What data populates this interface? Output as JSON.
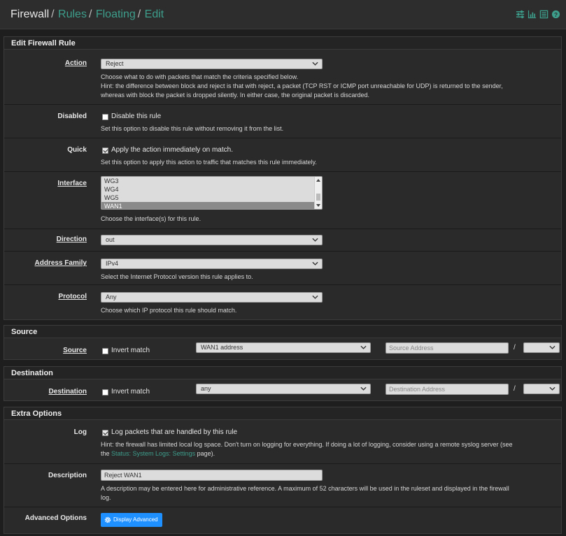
{
  "breadcrumb": {
    "firewall": "Firewall",
    "rules": "Rules",
    "floating": "Floating",
    "edit": "Edit",
    "sep": "/"
  },
  "header_icons": [
    "sliders-icon",
    "bar-chart-icon",
    "list-icon",
    "help-icon"
  ],
  "edit_panel": {
    "title": "Edit Firewall Rule",
    "action": {
      "label": "Action",
      "value": "Reject",
      "help1": "Choose what to do with packets that match the criteria specified below.",
      "help2": "Hint: the difference between block and reject is that with reject, a packet (TCP RST or ICMP port unreachable for UDP) is returned to the sender,",
      "help3": "whereas with block the packet is dropped silently. In either case, the original packet is discarded."
    },
    "disabled": {
      "label": "Disabled",
      "checkbox": "Disable this rule",
      "checked": false,
      "help": "Set this option to disable this rule without removing it from the list."
    },
    "quick": {
      "label": "Quick",
      "checkbox": "Apply the action immediately on match.",
      "checked": true,
      "help": "Set this option to apply this action to traffic that matches this rule immediately."
    },
    "interface": {
      "label": "Interface",
      "options": [
        "WG3",
        "WG4",
        "WG5",
        "WAN1"
      ],
      "selected": "WAN1",
      "help": "Choose the interface(s) for this rule."
    },
    "direction": {
      "label": "Direction",
      "value": "out"
    },
    "address_family": {
      "label": "Address Family",
      "value": "IPv4",
      "help": "Select the Internet Protocol version this rule applies to."
    },
    "protocol": {
      "label": "Protocol",
      "value": "Any",
      "help": "Choose which IP protocol this rule should match."
    }
  },
  "source_panel": {
    "title": "Source",
    "label": "Source",
    "invert": "Invert match",
    "type": "WAN1 address",
    "address_placeholder": "Source Address",
    "slash": "/"
  },
  "destination_panel": {
    "title": "Destination",
    "label": "Destination",
    "invert": "Invert match",
    "type": "any",
    "address_placeholder": "Destination Address",
    "slash": "/"
  },
  "extra_panel": {
    "title": "Extra Options",
    "log": {
      "label": "Log",
      "checkbox": "Log packets that are handled by this rule",
      "checked": true,
      "help1": "Hint: the firewall has limited local log space. Don't turn on logging for everything. If doing a lot of logging, consider using a remote syslog server (see",
      "help2_pre": "the ",
      "help2_link": "Status: System Logs: Settings",
      "help2_post": " page)."
    },
    "description": {
      "label": "Description",
      "value": "Reject WAN1",
      "help1": "A description may be entered here for administrative reference. A maximum of 52 characters will be used in the ruleset and displayed in the firewall",
      "help2": "log."
    },
    "advanced": {
      "label": "Advanced Options",
      "button": "Display Advanced"
    }
  },
  "colors": {
    "accent": "#3d9e8c",
    "button": "#1e90ff",
    "panel": "#2a2a2a",
    "background": "#1e1e1e"
  }
}
